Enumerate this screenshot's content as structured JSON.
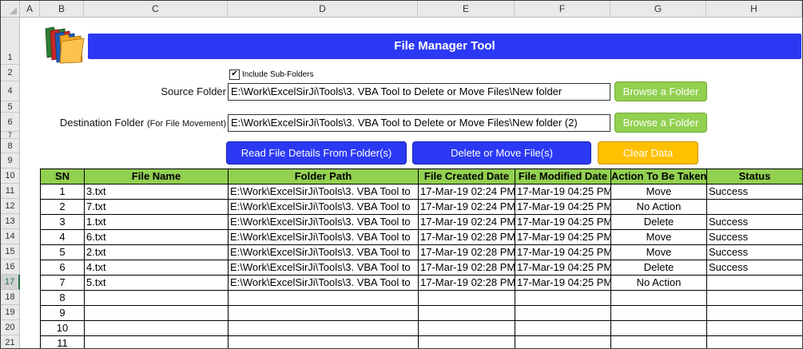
{
  "columns": [
    "A",
    "B",
    "C",
    "D",
    "E",
    "F",
    "G",
    "H"
  ],
  "rows": [
    "1",
    "2",
    "4",
    "5",
    "6",
    "7",
    "8",
    "9",
    "10",
    "11",
    "12",
    "13",
    "14",
    "15",
    "16",
    "17",
    "18",
    "19",
    "20",
    "21"
  ],
  "banner_title": "File Manager Tool",
  "icon": "folders-icon",
  "include_subfolders": {
    "label": "Include Sub-Folders",
    "checked": "✔"
  },
  "source": {
    "label": "Source Folder",
    "value": "E:\\Work\\ExcelSirJi\\Tools\\3. VBA Tool to Delete or Move Files\\New folder"
  },
  "destination": {
    "label": "Destination Folder",
    "note": "(For File Movement)",
    "value": "E:\\Work\\ExcelSirJi\\Tools\\3. VBA Tool to Delete or Move Files\\New folder (2)"
  },
  "buttons": {
    "browse_source": "Browse a Folder",
    "browse_dest": "Browse a Folder",
    "read": "Read File Details From Folder(s)",
    "delete_move": "Delete or Move File(s)",
    "clear": "Clear Data"
  },
  "colors": {
    "accent_blue": "#2b39f5",
    "green": "#92d050",
    "orange": "#ffc000"
  },
  "table": {
    "headers": [
      "SN",
      "File Name",
      "Folder Path",
      "File Created Date",
      "File Modified Date",
      "Action To Be Taken",
      "Status"
    ],
    "rows": [
      [
        "1",
        "3.txt",
        "E:\\Work\\ExcelSirJi\\Tools\\3. VBA Tool to",
        "17-Mar-19 02:24 PM",
        "17-Mar-19 04:25 PM",
        "Move",
        "Success"
      ],
      [
        "2",
        "7.txt",
        "E:\\Work\\ExcelSirJi\\Tools\\3. VBA Tool to",
        "17-Mar-19 02:24 PM",
        "17-Mar-19 04:25 PM",
        "No Action",
        ""
      ],
      [
        "3",
        "1.txt",
        "E:\\Work\\ExcelSirJi\\Tools\\3. VBA Tool to",
        "17-Mar-19 02:24 PM",
        "17-Mar-19 04:25 PM",
        "Delete",
        "Success"
      ],
      [
        "4",
        "6.txt",
        "E:\\Work\\ExcelSirJi\\Tools\\3. VBA Tool to",
        "17-Mar-19 02:28 PM",
        "17-Mar-19 04:25 PM",
        "Move",
        "Success"
      ],
      [
        "5",
        "2.txt",
        "E:\\Work\\ExcelSirJi\\Tools\\3. VBA Tool to",
        "17-Mar-19 02:28 PM",
        "17-Mar-19 04:25 PM",
        "Move",
        "Success"
      ],
      [
        "6",
        "4.txt",
        "E:\\Work\\ExcelSirJi\\Tools\\3. VBA Tool to",
        "17-Mar-19 02:28 PM",
        "17-Mar-19 04:25 PM",
        "Delete",
        "Success"
      ],
      [
        "7",
        "5.txt",
        "E:\\Work\\ExcelSirJi\\Tools\\3. VBA Tool to",
        "17-Mar-19 02:28 PM",
        "17-Mar-19 04:25 PM",
        "No Action",
        ""
      ],
      [
        "8",
        "",
        "",
        "",
        "",
        "",
        ""
      ],
      [
        "9",
        "",
        "",
        "",
        "",
        "",
        ""
      ],
      [
        "10",
        "",
        "",
        "",
        "",
        "",
        ""
      ],
      [
        "11",
        "",
        "",
        "",
        "",
        "",
        ""
      ]
    ]
  }
}
